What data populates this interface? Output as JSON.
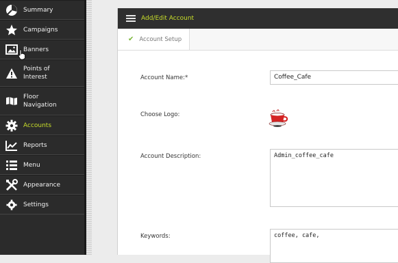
{
  "sidebar": {
    "items": [
      {
        "label": "Summary",
        "icon": "summary-pie-icon"
      },
      {
        "label": "Campaigns",
        "icon": "star-icon"
      },
      {
        "label": "Banners",
        "icon": "image-icon"
      },
      {
        "label": "Points of\nInterest",
        "icon": "warning-icon"
      },
      {
        "label": "Floor\nNavigation",
        "icon": "map-icon"
      },
      {
        "label": "Accounts",
        "icon": "gear-icon"
      },
      {
        "label": "Reports",
        "icon": "chart-icon"
      },
      {
        "label": "Menu",
        "icon": "list-icon"
      },
      {
        "label": "Appearance",
        "icon": "tools-icon"
      },
      {
        "label": "Settings",
        "icon": "settings-icon"
      }
    ],
    "active_index": 5,
    "active_color": "#c9df2a"
  },
  "panel": {
    "title": "Add/Edit Account",
    "tab_label": "Account Setup"
  },
  "form": {
    "account_name_label": "Account Name:*",
    "account_name_value": "Coffee_Cafe",
    "choose_logo_label": "Choose Logo:",
    "description_label": "Account Description:",
    "description_value": "Admin_coffee_cafe",
    "keywords_label": "Keywords:",
    "keywords_value": "coffee, cafe,"
  }
}
